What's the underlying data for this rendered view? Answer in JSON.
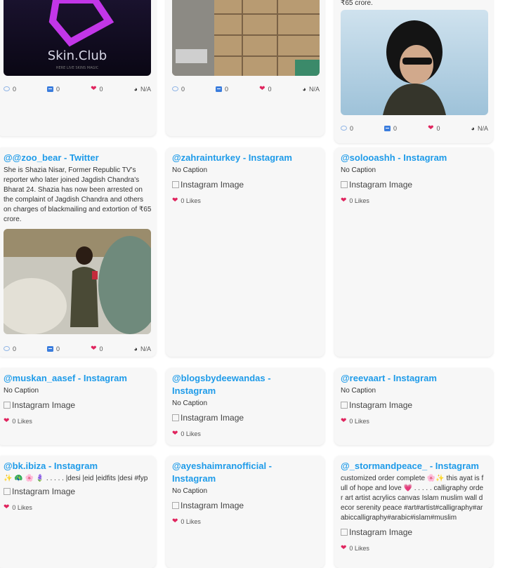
{
  "common": {
    "likes_icon": "heart-icon",
    "stat_na": "N/A",
    "no_caption": "No Caption",
    "img_alt": "Instagram Image"
  },
  "top": {
    "card1": {
      "media_text": "Skin.Club",
      "media_sub": "HERE LIVE SKINS MAGIC",
      "comments": "0",
      "retweets": "0",
      "likes": "0",
      "views": "N/A"
    },
    "card2": {
      "comments": "0",
      "retweets": "0",
      "likes": "0",
      "views": "N/A"
    },
    "card3": {
      "caption_tail": "₹65 crore.",
      "comments": "0",
      "retweets": "0",
      "likes": "0",
      "views": "N/A"
    }
  },
  "row2": {
    "card1": {
      "title": "@@zoo_bear - Twitter",
      "caption": "She is Shazia Nisar, Former Republic TV's reporter who later joined Jagdish Chandra's Bharat 24. Shazia has now been arrested on the complaint of Jagdish Chandra and others on charges of blackmailing and extortion of ₹65 crore.",
      "comments": "0",
      "retweets": "0",
      "likes": "0",
      "views": "N/A"
    },
    "card2": {
      "title": "@zahrainturkey - Instagram",
      "caption": "No Caption",
      "img": "Instagram Image",
      "likes": "0 Likes"
    },
    "card3": {
      "title": "@solooashh - Instagram",
      "caption": "No Caption",
      "img": "Instagram Image",
      "likes": "0 Likes"
    }
  },
  "row3": {
    "card1": {
      "title": "@muskan_aasef - Instagram",
      "caption": "No Caption",
      "img": "Instagram Image",
      "likes": "0 Likes"
    },
    "card2": {
      "title": "@blogsbydeewandas - Instagram",
      "caption": "No Caption",
      "img": "Instagram Image",
      "likes": "0 Likes"
    },
    "card3": {
      "title": "@reevaart - Instagram",
      "caption": "No Caption",
      "img": "Instagram Image",
      "likes": "0 Likes"
    }
  },
  "row4": {
    "card1": {
      "title": "@bk.ibiza - Instagram",
      "caption": "✨ 🦚 🌸 🪻 . . . . . |desi |eid |eidfits |desi #fyp",
      "img": "Instagram Image",
      "likes": "0 Likes"
    },
    "card2": {
      "title": "@ayeshaimranofficial - Instagram",
      "caption": "No Caption",
      "img": "Instagram Image",
      "likes": "0 Likes"
    },
    "card3": {
      "title": "@_stormandpeace_ - Instagram",
      "caption": "customized order complete 🌸✨ this ayat is full of hope and love 💗 . . . . . calligraphy order art artist acrylics canvas Islam muslim wall decor serenity peace #art#artist#calligraphy#arabiccalligraphy#arabic#islam#muslim",
      "img": "Instagram Image",
      "likes": "0 Likes"
    }
  }
}
